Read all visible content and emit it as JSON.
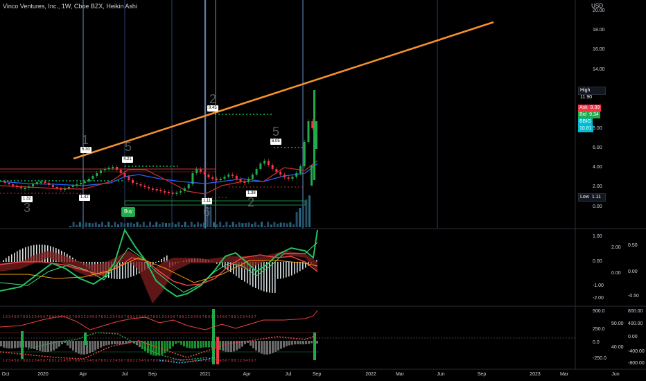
{
  "header": {
    "title": "Vinco Ventures, Inc., 1W, Cboe BZX, Heikin Ashi",
    "currency": "USD"
  },
  "price_axis": {
    "ticks": [
      "20.00",
      "18.00",
      "16.00",
      "14.00",
      "12.00",
      "10.00",
      "8.00",
      "6.00",
      "4.00",
      "2.00",
      "0.00"
    ],
    "high": {
      "label": "High",
      "value": "11.90"
    },
    "ask": {
      "label": "Ask",
      "value": "9.39"
    },
    "bid": {
      "label": "Bid",
      "value": "9.34"
    },
    "last": {
      "label": "BBIG",
      "value": "10.81"
    },
    "low": {
      "label": "Low",
      "value": "1.11"
    }
  },
  "time_axis": {
    "ticks": [
      "Oct",
      "2020",
      "Apr",
      "Jul",
      "Sep",
      "2021",
      "Apr",
      "Jul",
      "Sep",
      "2022",
      "Mar",
      "Jun",
      "Sep",
      "2023",
      "Mar",
      "Jun"
    ]
  },
  "annotations": {
    "price_tags": [
      "1.32",
      "5.30",
      "1.42",
      "4.21",
      "9.45",
      "1.11",
      "6.05",
      "1.38"
    ],
    "buy_label": "Buy",
    "wave_labels": [
      "3",
      "1",
      "5",
      "2",
      "6",
      "5",
      "2"
    ]
  },
  "macd_axis": {
    "left_ticks": [
      "1.00",
      "0.00",
      "-1.00",
      "-2.00"
    ],
    "mid_ticks": [
      "2.00",
      "0.00"
    ],
    "right_ticks": [
      "0.50",
      "0.00",
      "-0.50"
    ]
  },
  "osc_axis": {
    "left_ticks": [
      "500.0",
      "250.0",
      "0.0",
      "-250.0"
    ],
    "mid_ticks": [
      "50.00",
      "40.00"
    ],
    "right_ticks": [
      "800.00",
      "400.00",
      "0.00",
      "-400.00",
      "-800.00"
    ]
  },
  "colors": {
    "background": "#000000",
    "trendline": "#f5922f",
    "up": "#22ab4a",
    "down": "#f23645",
    "ma_blue": "#2962ff",
    "dotted_green": "#00e676"
  },
  "chart_data": {
    "type": "line",
    "title": "Vinco Ventures, Inc., 1W, Cboe BZX, Heikin Ashi",
    "x": [
      "2019-10",
      "2020-01",
      "2020-04",
      "2020-07",
      "2020-09",
      "2021-01",
      "2021-04",
      "2021-07",
      "2021-09"
    ],
    "series": [
      {
        "values": [
          2.3,
          1.6,
          1.6,
          3.6,
          2.4,
          1.4,
          2.2,
          4.4,
          10.8
        ]
      }
    ],
    "ylim": [
      0,
      20
    ]
  }
}
